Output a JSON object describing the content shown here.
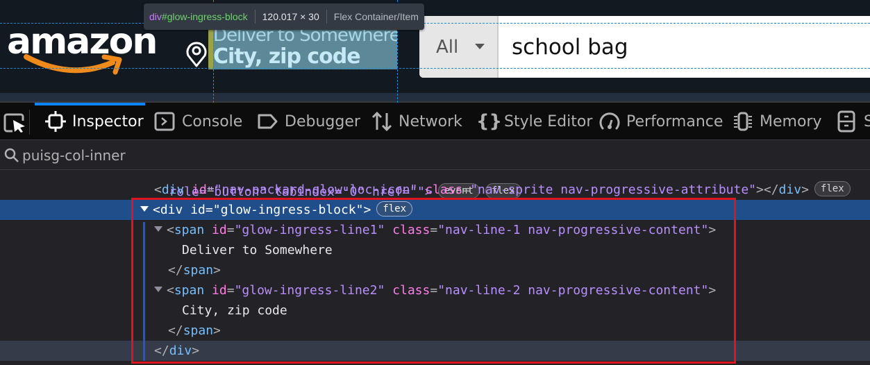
{
  "page": {
    "logo_text": "amazon",
    "delivery": {
      "line1": "Deliver to Somewhere",
      "line2": "City, zip code"
    },
    "search": {
      "category": "All",
      "query": "school bag"
    }
  },
  "infobar": {
    "tag": "div",
    "id": "#glow-ingress-block",
    "dimensions": "120.017 × 30",
    "kind": "Flex Container/Item"
  },
  "devtools": {
    "tabs": [
      {
        "label": "Inspector",
        "icon": "inspector-icon",
        "selected": true
      },
      {
        "label": "Console",
        "icon": "console-icon",
        "selected": false
      },
      {
        "label": "Debugger",
        "icon": "debugger-icon",
        "selected": false
      },
      {
        "label": "Network",
        "icon": "network-icon",
        "selected": false
      },
      {
        "label": "Style Editor",
        "icon": "style-editor-icon",
        "selected": false
      },
      {
        "label": "Performance",
        "icon": "performance-icon",
        "selected": false
      },
      {
        "label": "Memory",
        "icon": "memory-icon",
        "selected": false
      },
      {
        "label": "S",
        "icon": "storage-icon",
        "selected": false
      }
    ],
    "filter": {
      "value": "puisg-col-inner"
    },
    "markup": {
      "cut_line": {
        "text": "role=\"button\" tabindex=\"0\" href=\"\">",
        "badges": [
          "event",
          "flex"
        ]
      },
      "loc_icon_line": {
        "tag": "div",
        "id_attr": "id",
        "id_val": "\"nav-packard-glow-loc-icon\"",
        "class_attr": "class",
        "class_val": "\"nav-sprite nav-progressive-attribute\"",
        "badge": "flex"
      },
      "block_line": {
        "tag": "div",
        "id_attr": "id",
        "id_val": "\"glow-ingress-block\"",
        "badge": "flex"
      },
      "line1_open": {
        "tag": "span",
        "id_attr": "id",
        "id_val": "\"glow-ingress-line1\"",
        "class_attr": "class",
        "class_val": "\"nav-line-1 nav-progressive-content\""
      },
      "line1_text": "Deliver to Somewhere",
      "line1_close": "span",
      "line2_open": {
        "tag": "span",
        "id_attr": "id",
        "id_val": "\"glow-ingress-line2\"",
        "class_attr": "class",
        "class_val": "\"nav-line-2 nav-progressive-content\""
      },
      "line2_text": "City, zip code",
      "line2_close": "span",
      "block_close": "div"
    }
  },
  "colors": {
    "accent": "#0a84ff",
    "selection": "#204e8a",
    "highlight_border": "#e0141e",
    "amazon_orange": "#f08a1a"
  }
}
